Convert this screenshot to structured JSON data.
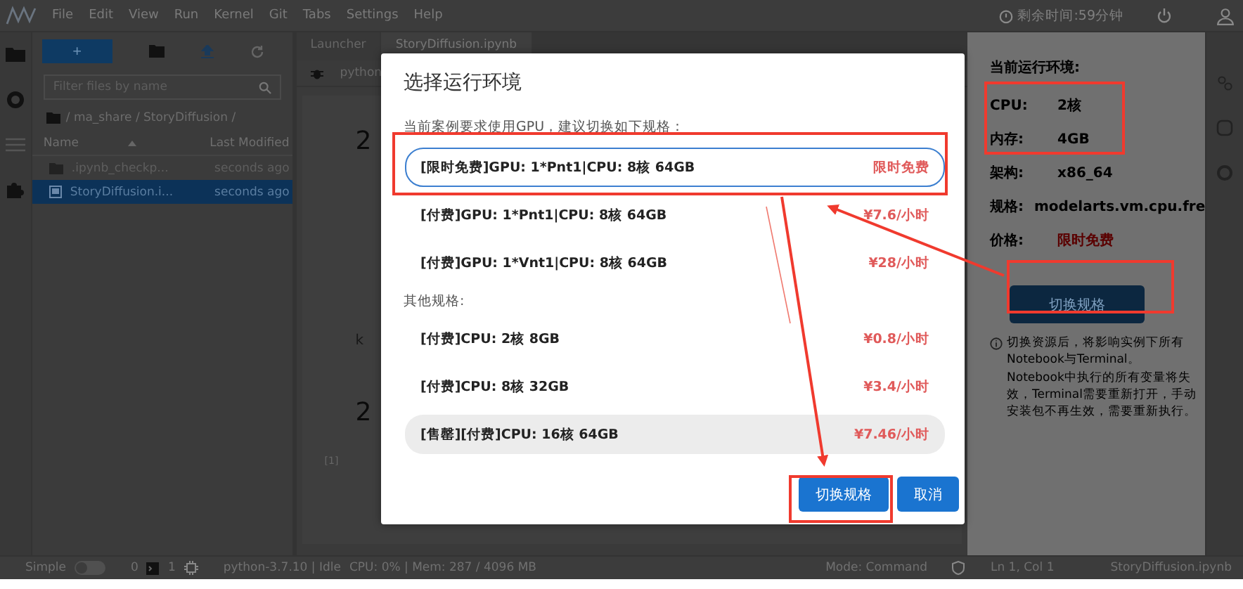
{
  "menu": {
    "items": [
      "File",
      "Edit",
      "View",
      "Run",
      "Kernel",
      "Git",
      "Tabs",
      "Settings",
      "Help"
    ],
    "timer": "剩余时间:59分钟"
  },
  "file_browser": {
    "new_button": "+",
    "filter_placeholder": "Filter files by name",
    "breadcrumb": "/ ma_share / StoryDiffusion /",
    "columns": [
      "Name",
      "Last Modified"
    ],
    "rows": [
      {
        "name": ".ipynb_checkp...",
        "modified": "seconds ago",
        "kind": "folder",
        "selected": false
      },
      {
        "name": "StoryDiffusion.i...",
        "modified": "seconds ago",
        "kind": "notebook",
        "selected": true
      }
    ]
  },
  "tabs": [
    {
      "label": "Launcher",
      "selected": false
    },
    {
      "label": "StoryDiffusion.ipynb",
      "selected": true
    }
  ],
  "notebook": {
    "kernel": "python",
    "texts": [
      "2",
      "k",
      "2"
    ],
    "prompt": "[1]"
  },
  "dialog": {
    "title": "选择运行环境",
    "intro": "当前案例要求使用GPU，建议切换如下规格：",
    "recommended": [
      {
        "spec": "[限时免费]GPU: 1*Pnt1|CPU: 8核 64GB",
        "price": "限时免费",
        "selected": true,
        "disabled": false
      },
      {
        "spec": "[付费]GPU: 1*Pnt1|CPU: 8核 64GB",
        "price": "¥7.6/小时",
        "selected": false,
        "disabled": false
      },
      {
        "spec": "[付费]GPU: 1*Vnt1|CPU: 8核 64GB",
        "price": "¥28/小时",
        "selected": false,
        "disabled": false
      }
    ],
    "other_label": "其他规格:",
    "others": [
      {
        "spec": "[付费]CPU: 2核 8GB",
        "price": "¥0.8/小时",
        "selected": false,
        "disabled": false
      },
      {
        "spec": "[付费]CPU: 8核 32GB",
        "price": "¥3.4/小时",
        "selected": false,
        "disabled": false
      },
      {
        "spec": "[售罄][付费]CPU: 16核 64GB",
        "price": "¥7.46/小时",
        "selected": false,
        "disabled": true
      }
    ],
    "confirm": "切换规格",
    "cancel": "取消"
  },
  "env_panel": {
    "title": "当前运行环境:",
    "rows": [
      {
        "label": "CPU:",
        "value": "2核",
        "kind": "plain"
      },
      {
        "label": "内存:",
        "value": "4GB",
        "kind": "plain"
      },
      {
        "label": "架构:",
        "value": "x86_64",
        "kind": "plain"
      },
      {
        "label": "规格:",
        "value": "modelarts.vm.cpu.fre",
        "kind": "plain"
      },
      {
        "label": "价格:",
        "value": "限时免费",
        "kind": "price"
      }
    ],
    "button": "切换规格",
    "note": "切换资源后，将影响实例下所有Notebook与Terminal。Notebook中执行的所有变量将失效，Terminal需要重新打开，手动安装包不再生效，需要重新执行。"
  },
  "status_bar": {
    "mode_label": "Simple",
    "simple_on": false,
    "terminals": "0",
    "kernels": "1",
    "kernel": "python-3.7.10 | Idle",
    "resources": "CPU: 0% | Mem: 287 / 4096 MB",
    "mode": "Mode: Command",
    "position": "Ln 1, Col 1",
    "file": "StoryDiffusion.ipynb"
  }
}
